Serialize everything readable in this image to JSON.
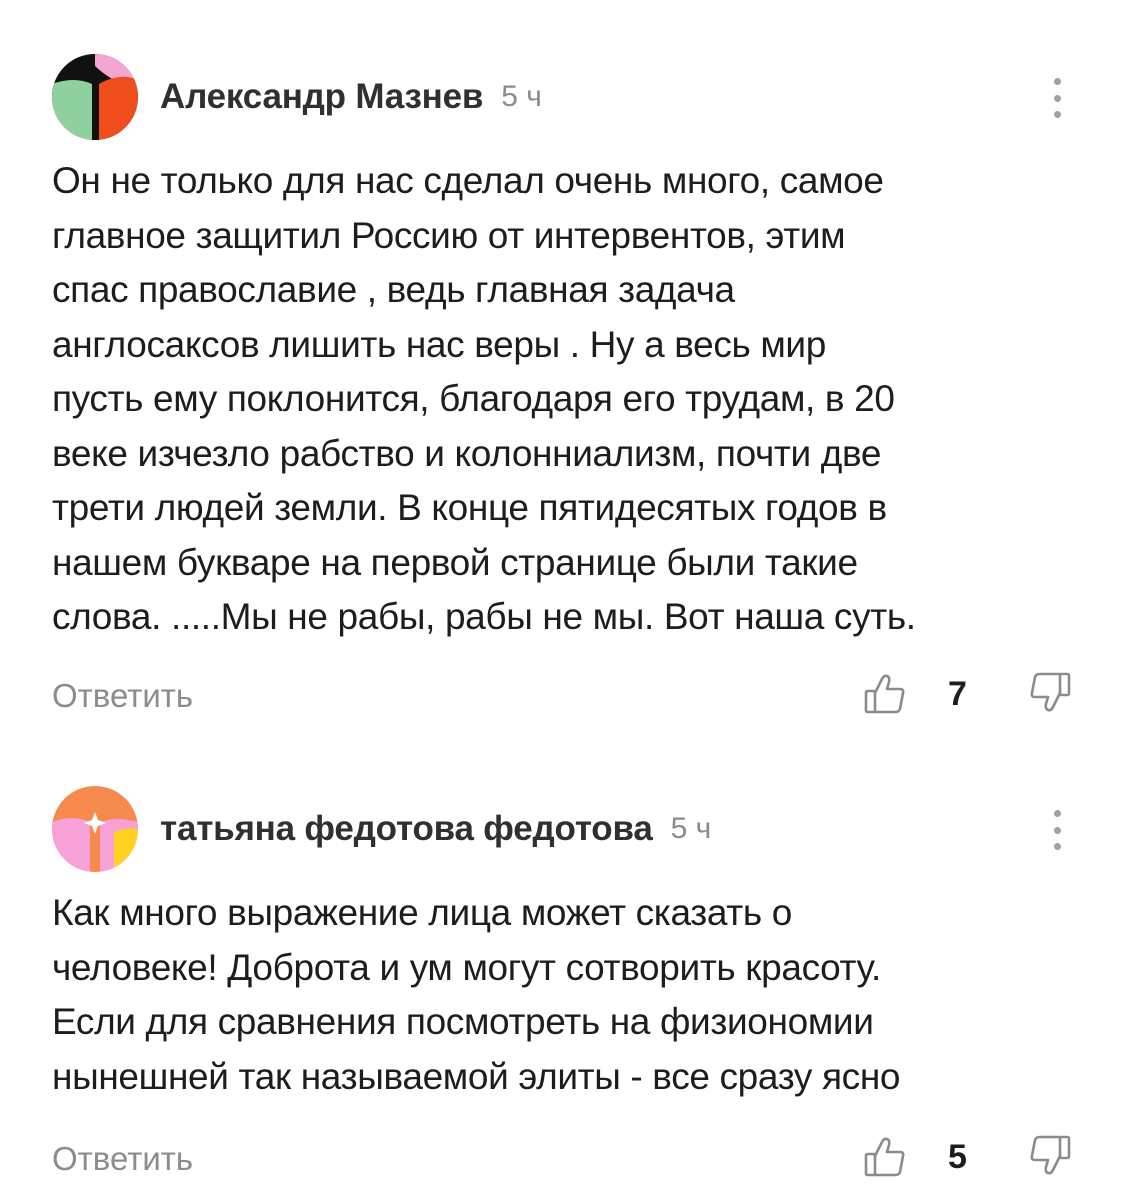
{
  "comments": [
    {
      "author": "Александр Мазнев",
      "time": "5 ч",
      "text_lines": [
        "Он не только для нас сделал очень много, самое",
        "главное защитил Россию от интервентов, этим",
        "спас православие , ведь главная задача",
        "англосаксов лишить нас веры . Ну а весь мир",
        "пусть ему поклонится, благодаря его трудам, в 20",
        "веке изчезло рабство и колонниализм, почти две",
        "трети людей земли. В конце пятидесятых годов в",
        "нашем букваре на первой странице были такие",
        "слова. .....Мы не рабы, рабы не мы. Вот наша суть."
      ],
      "reply_label": "Ответить",
      "likes": "7",
      "avatar_icon": "avatar-icon",
      "avatar_colors": [
        "#8fd19e",
        "#f04d1c",
        "#111111",
        "#f4a6d0"
      ]
    },
    {
      "author": "татьяна федотова федотова",
      "time": "5 ч",
      "text_lines": [
        "Как много выражение лица может сказать о",
        "человеке! Доброта и ум могут сотворить красоту.",
        "Если для сравнения посмотреть на физиономии",
        "нынешней так называемой элиты - все сразу ясно"
      ],
      "reply_label": "Ответить",
      "likes": "5",
      "avatar_icon": "avatar-icon",
      "avatar_colors": [
        "#f58a4c",
        "#f7a1d6",
        "#ffd21f",
        "#ffffff"
      ]
    }
  ],
  "icons": {
    "more": "more-vertical-icon",
    "like": "thumbs-up-icon",
    "dislike": "thumbs-down-icon"
  },
  "colors": {
    "text": "#1d1d1f",
    "muted": "#8b8b8b",
    "author": "#303030"
  }
}
